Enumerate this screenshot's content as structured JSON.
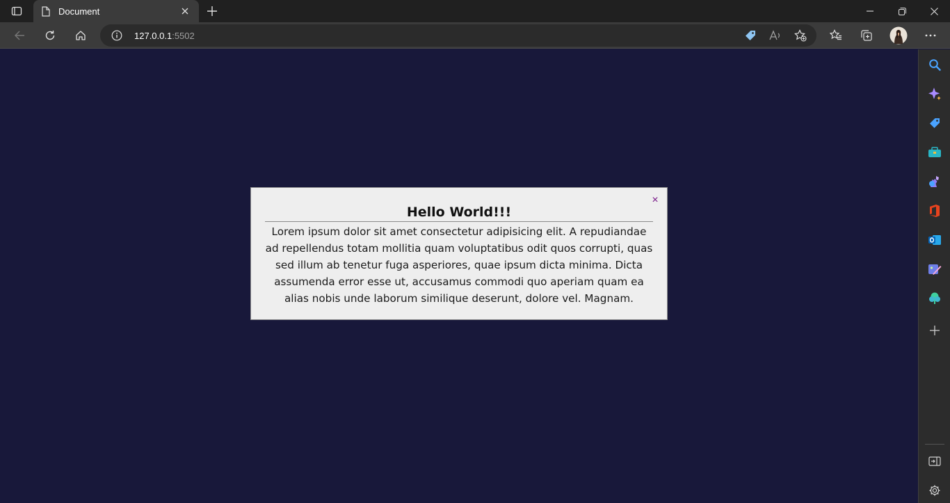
{
  "browser": {
    "tab_title": "Document",
    "url_host": "127.0.0.1",
    "url_port": ":5502"
  },
  "modal": {
    "title": "Hello World!!!",
    "close_label": "×",
    "body": "Lorem ipsum dolor sit amet consectetur adipisicing elit. A repudiandae ad repellendus totam mollitia quam voluptatibus odit quos corrupti, quas sed illum ab tenetur fuga asperiores, quae ipsum dicta minima. Dicta assumenda error esse ut, accusamus commodi quo aperiam quam ea alias nobis unde laborum similique deserunt, dolore vel. Magnam."
  },
  "colors": {
    "page_bg": "#18183a",
    "modal_bg": "#eeeeee",
    "close_accent": "#7a1b8a"
  },
  "sidebar_icons": [
    "search-icon",
    "copilot-icon",
    "shopping-tag-icon",
    "toolbox-icon",
    "games-icon",
    "office-icon",
    "outlook-icon",
    "designer-icon",
    "tree-icon",
    "add-icon",
    "hide-sidebar-icon",
    "settings-icon"
  ]
}
